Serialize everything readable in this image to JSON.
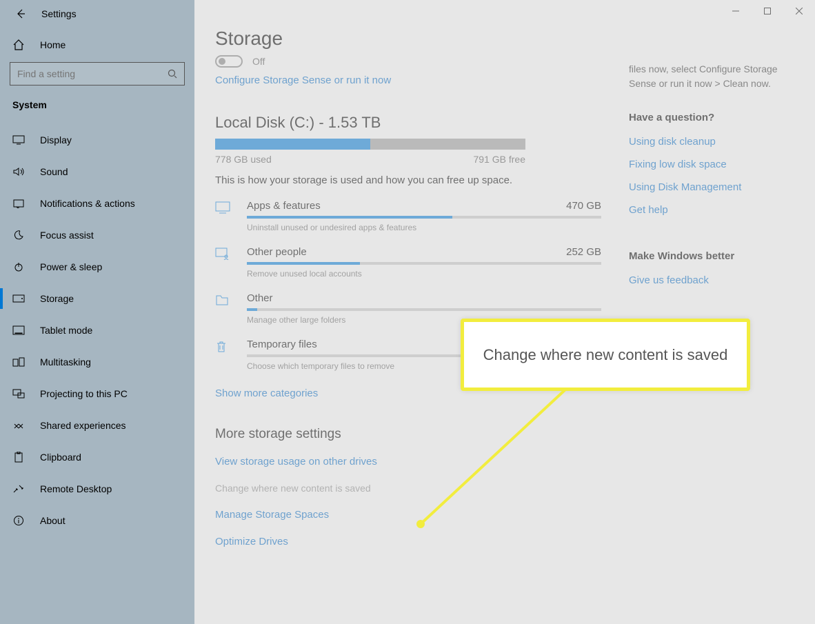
{
  "app_title": "Settings",
  "home_label": "Home",
  "search_placeholder": "Find a setting",
  "section_label": "System",
  "nav_items": [
    {
      "label": "Display"
    },
    {
      "label": "Sound"
    },
    {
      "label": "Notifications & actions"
    },
    {
      "label": "Focus assist"
    },
    {
      "label": "Power & sleep"
    },
    {
      "label": "Storage"
    },
    {
      "label": "Tablet mode"
    },
    {
      "label": "Multitasking"
    },
    {
      "label": "Projecting to this PC"
    },
    {
      "label": "Shared experiences"
    },
    {
      "label": "Clipboard"
    },
    {
      "label": "Remote Desktop"
    },
    {
      "label": "About"
    }
  ],
  "page_title": "Storage",
  "toggle_label": "Off",
  "configure_link": "Configure Storage Sense or run it now",
  "disk": {
    "title": "Local Disk (C:) - 1.53 TB",
    "used": "778 GB used",
    "free": "791 GB free",
    "desc": "This is how your storage is used and how you can free up space.",
    "fill_pct": 50
  },
  "categories": [
    {
      "name": "Apps & features",
      "size": "470 GB",
      "sub": "Uninstall unused or undesired apps & features",
      "fill": 58
    },
    {
      "name": "Other people",
      "size": "252 GB",
      "sub": "Remove unused local accounts",
      "fill": 32
    },
    {
      "name": "Other",
      "size": "",
      "sub": "Manage other large folders",
      "fill": 3
    },
    {
      "name": "Temporary files",
      "size": "",
      "sub": "Choose which temporary files to remove",
      "fill": 0
    }
  ],
  "show_more": "Show more categories",
  "more_title": "More storage settings",
  "more_links": {
    "view_usage": "View storage usage on other drives",
    "change_where": "Change where new content is saved",
    "manage_spaces": "Manage Storage Spaces",
    "optimize": "Optimize Drives"
  },
  "right": {
    "intro_text": "files now, select Configure Storage Sense or run it now > Clean now.",
    "question_heading": "Have a question?",
    "question_links": [
      "Using disk cleanup",
      "Fixing low disk space",
      "Using Disk Management",
      "Get help"
    ],
    "better_heading": "Make Windows better",
    "feedback_link": "Give us feedback"
  },
  "callout_text": "Change where new content is saved"
}
